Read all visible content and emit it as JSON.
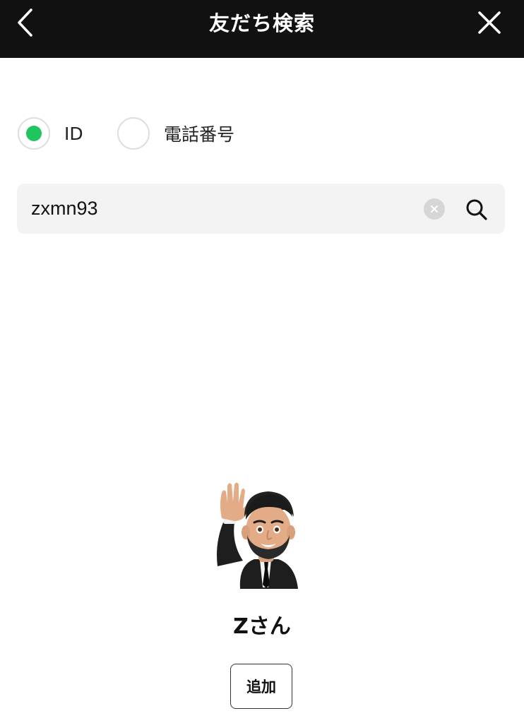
{
  "header": {
    "title": "友だち検索",
    "back_icon": "chevron-left-icon",
    "close_icon": "close-icon",
    "background": "#111111"
  },
  "search_type": {
    "options": [
      {
        "label": "ID",
        "selected": true
      },
      {
        "label": "電話番号",
        "selected": false
      }
    ],
    "accent_color": "#1fc55d"
  },
  "search": {
    "value": "zxmn93",
    "clear_icon": "clear-icon",
    "search_icon": "search-icon"
  },
  "result": {
    "avatar_icon": "memoji-waving-avatar",
    "name": "Zさん",
    "add_label": "追加"
  }
}
